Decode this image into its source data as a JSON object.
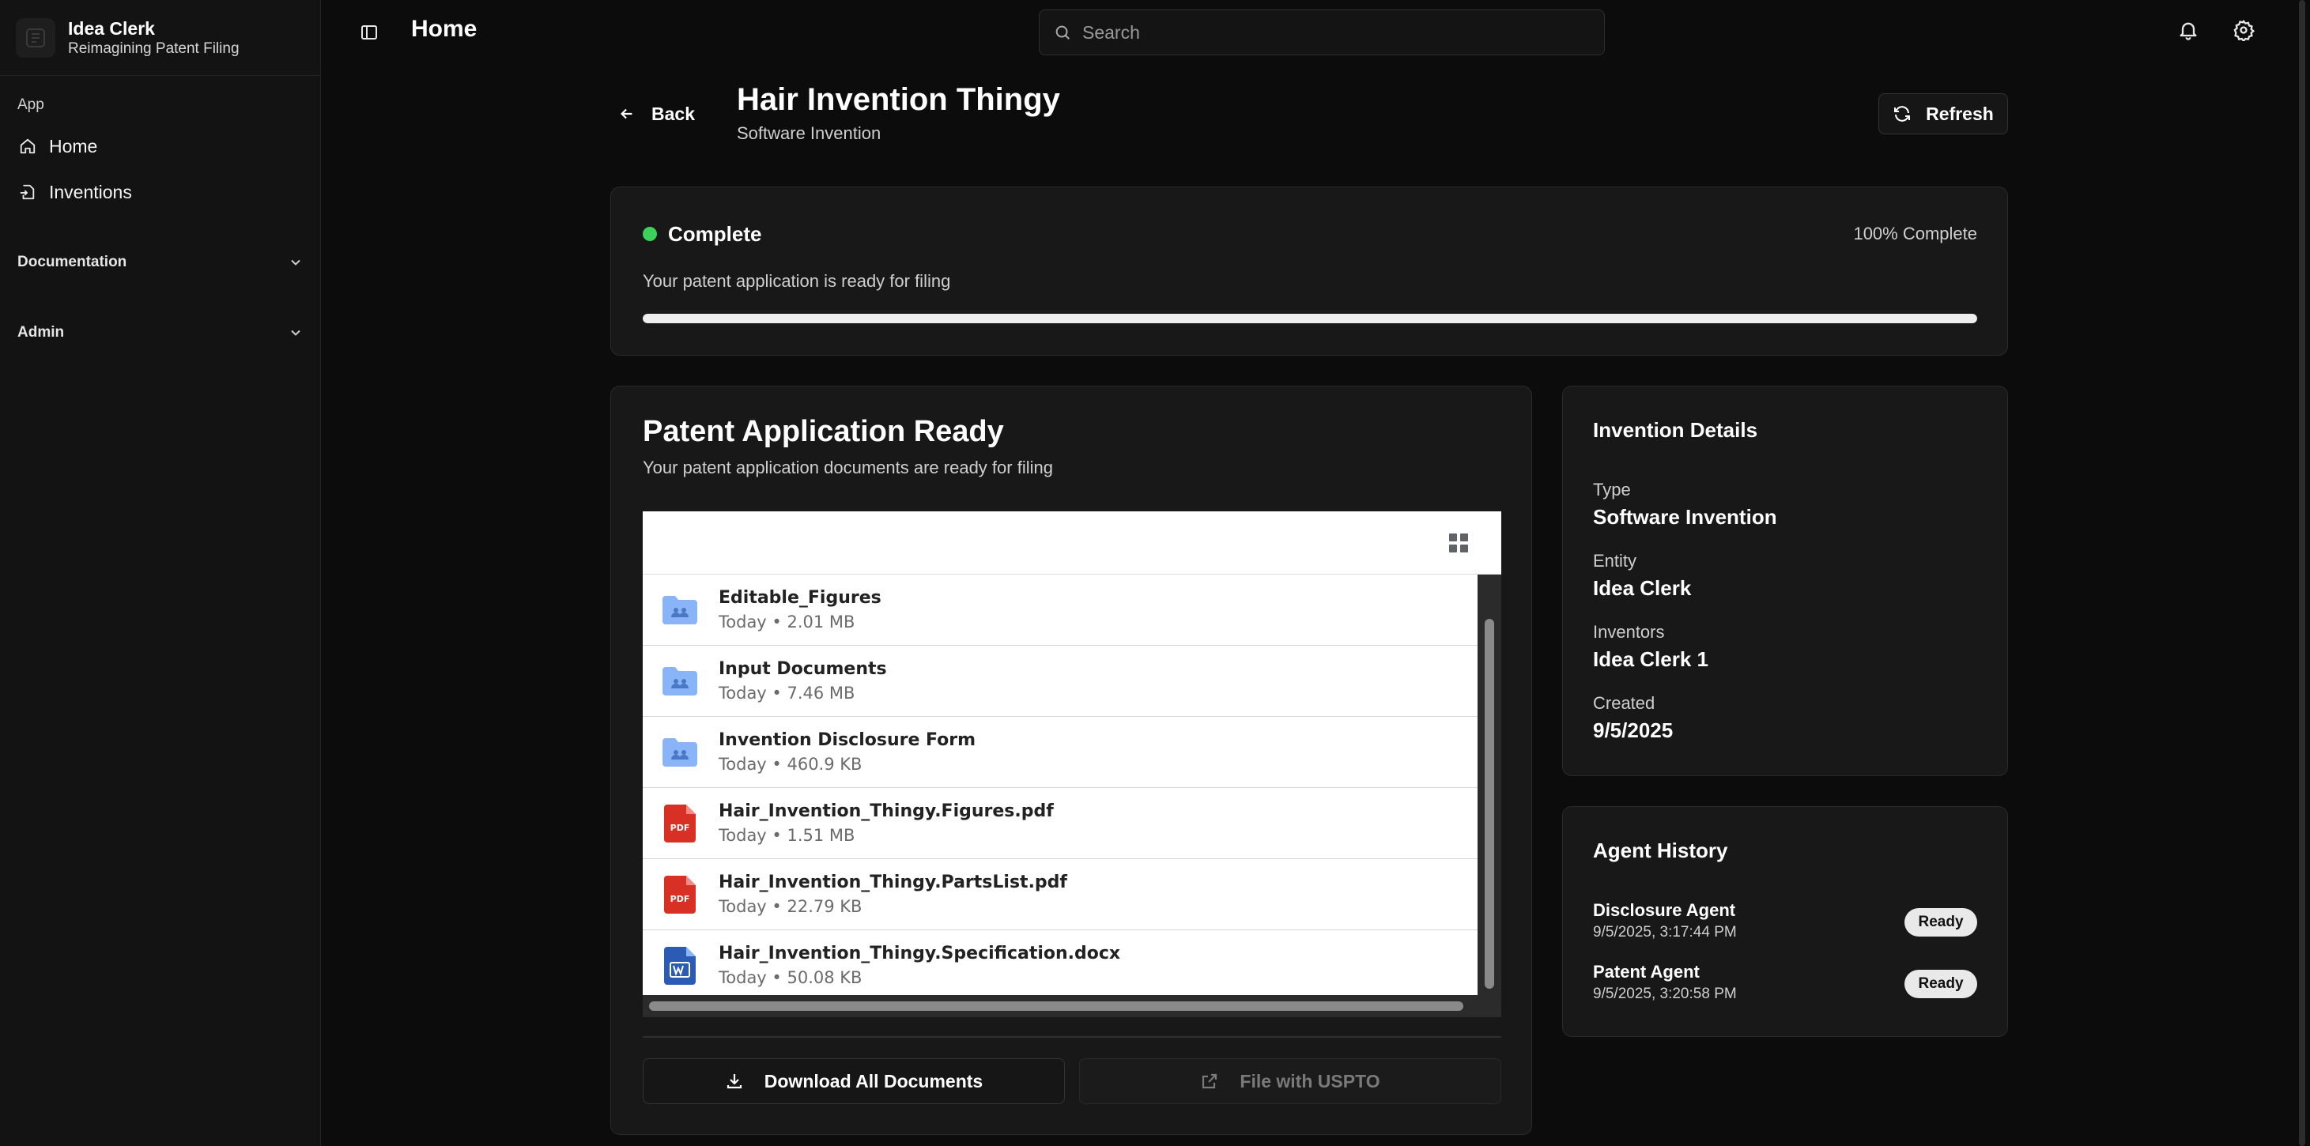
{
  "brand": {
    "name": "Idea Clerk",
    "tagline": "Reimagining Patent Filing"
  },
  "sidebar": {
    "group_label": "App",
    "items": [
      {
        "label": "Home",
        "icon": "home-icon"
      },
      {
        "label": "Inventions",
        "icon": "file-import-icon"
      }
    ],
    "sections": [
      {
        "label": "Documentation",
        "icon": "chevron-down-icon"
      },
      {
        "label": "Admin",
        "icon": "chevron-down-icon"
      }
    ]
  },
  "topbar": {
    "title": "Home",
    "search_placeholder": "Search"
  },
  "header": {
    "back_label": "Back",
    "title": "Hair Invention Thingy",
    "subtitle": "Software Invention",
    "refresh_label": "Refresh"
  },
  "status": {
    "label": "Complete",
    "percent_text": "100% Complete",
    "progress": 100,
    "message": "Your patent application is ready for filing",
    "dot_color": "#3bd15a"
  },
  "documents": {
    "title": "Patent Application Ready",
    "subtitle": "Your patent application documents are ready for filing",
    "files": [
      {
        "name": "Editable_Figures",
        "info": "Today • 2.01 MB",
        "type": "folder"
      },
      {
        "name": "Input Documents",
        "info": "Today • 7.46 MB",
        "type": "folder"
      },
      {
        "name": "Invention Disclosure Form",
        "info": "Today • 460.9 KB",
        "type": "folder"
      },
      {
        "name": "Hair_Invention_Thingy.Figures.pdf",
        "info": "Today • 1.51 MB",
        "type": "pdf"
      },
      {
        "name": "Hair_Invention_Thingy.PartsList.pdf",
        "info": "Today • 22.79 KB",
        "type": "pdf"
      },
      {
        "name": "Hair_Invention_Thingy.Specification.docx",
        "info": "Today • 50.08 KB",
        "type": "docx"
      }
    ],
    "download_label": "Download All Documents",
    "uspto_label": "File with USPTO"
  },
  "details": {
    "title": "Invention Details",
    "fields": [
      {
        "label": "Type",
        "value": "Software Invention"
      },
      {
        "label": "Entity",
        "value": "Idea Clerk"
      },
      {
        "label": "Inventors",
        "value": "Idea Clerk 1"
      },
      {
        "label": "Created",
        "value": "9/5/2025"
      }
    ]
  },
  "agents": {
    "title": "Agent History",
    "items": [
      {
        "name": "Disclosure Agent",
        "time": "9/5/2025, 3:17:44 PM",
        "status": "Ready"
      },
      {
        "name": "Patent Agent",
        "time": "9/5/2025, 3:20:58 PM",
        "status": "Ready"
      }
    ]
  },
  "colors": {
    "background": "#0c0c0c",
    "card": "#181818",
    "folder": "#8ab4f8",
    "pdf": "#d93025",
    "docx": "#2b5bb5",
    "success": "#3bd15a"
  }
}
